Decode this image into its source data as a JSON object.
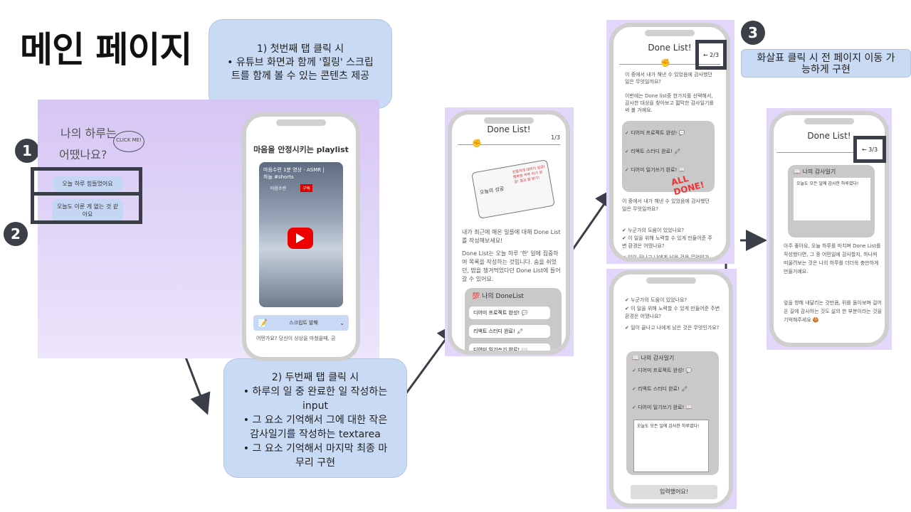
{
  "page_title": "메인 페이지",
  "callouts": {
    "first": [
      "1) 첫번째 탭 클릭 시",
      "• 유튜브 화면과 함께 '힐링' 스크립",
      "트를 함께 볼 수 있는 콘텐츠 제공"
    ],
    "second": [
      "2) 두번째 탭 클릭 시",
      "• 하루의 일 중 완료한 일 작성하는",
      "input",
      "• 그 요소 기억해서 그에 대한 작은",
      "감사일기를 작성하는 textarea",
      "• 그 요소 기억해서 마지막 최종 마",
      "무리 구현"
    ],
    "third": [
      "화살표 클릭 시 전 페이지 이동 가",
      "능하게 구현"
    ]
  },
  "badges": {
    "one": "1",
    "two": "2",
    "three": "3"
  },
  "main_panel": {
    "question_line1": "나의 하루는",
    "question_line2": "어땠나요?",
    "click_me": "CLICK ME!",
    "btn_hard": "오늘 하루 힘들었어요",
    "btn_nothing": "오늘도 이룬 게 없는 것 같아요"
  },
  "playlist_phone": {
    "title": "마음을 안정시키는 playlist",
    "video_title": "마음수련 1분 영상 - ASMR | 하늘 #shorts",
    "channel": "마음수련",
    "subscribe": "구독",
    "script_btn": "스크립트 발췌",
    "footer": "어떤가요? 당신이 상상을 마쳤을때, 긍"
  },
  "done_phone1": {
    "title": "Done List!",
    "step": "1/3",
    "book_left": "오늘의 성공",
    "book_right": "친절하게 대하기 성공! 행복한 하루 되기 성공! 결과 잘 받기!",
    "intro1": "내가 최근에 해온 일들에 대해 Done List를 작성해보세요!",
    "intro2": "Done List는 오늘 하루 '한' 일에 집중하여 목록을 작성하는 것입니다. 숨을 쉬었던, 밥을 챙겨먹었다던 Done List에 들어 갈 수 있어요.",
    "card_title": "나의 DoneList",
    "items": [
      "디어미 프로젝트 완성! 💬",
      "리액트 스터디 완료! 🖍",
      "디어미 일기쓰기 완료! 📖"
    ]
  },
  "done_phone2": {
    "title": "Done List!",
    "step": "← 2/3",
    "q1": "이 중에서 내가 해낸 수 있었음에 감사했던 일은 무엇일까요?",
    "q2": "이번에는 Done list중 한가지를 선택해서, 감사한 대상을 찾아보고 짧막한 감사일기를 써 볼 거예요.",
    "items": [
      "✓ 디어미 프로젝트 완성! 💬",
      "✓ 리액트 스터디 완료! 🖍",
      "✓ 디어미 일기쓰기 완료! 📖"
    ],
    "stamp": "ALL DONE!",
    "q3": "이 중에서 내가 해낸 수 있었음에 감사했던 일은 무엇일까요?",
    "checks": [
      "✔ 누군가의 도움이 있었나요?",
      "✔ 이 일을 위해 노력할 수 있게 만들어준 주변 환경은 어땠나요?",
      "✔ 일이 끝나고 나에게 남은 것은 무엇인가요?"
    ]
  },
  "done_phone3": {
    "checks": [
      "✔ 누군가의 도움이 있었나요?",
      "✔ 이 일을 위해 노력할 수 있게 만들어준 주변 환경은 어땠나요?",
      "✔ 일이 끝나고 나에게 남은 것은 무엇인가요?"
    ],
    "card_title": "📖 나의 감사일기",
    "items": [
      "✓ 디어미 프로젝트 완성! 💬",
      "✓ 리액트 스터디 완료! 🖍",
      "✓ 디어미 일기쓰기 완료! 📖"
    ],
    "textarea": "오늘도 모든 일에 감사한 하루였다!",
    "submit": "입력했어요!"
  },
  "done_phone4": {
    "title": "Done List!",
    "step": "← 3/3",
    "card_title": "📖 나의 감사일기",
    "diary": "오늘도 모든 일에 감사한 하루였다!",
    "para1": "아주 좋아요, 오늘 하루를 마치며 Done List를 작성했다면, 그 중 어떤일에 감사할지, 하나씩 떠올려보는 것은 나의 하루를 더더욱 충만하게 만들거예요.",
    "para2": "앞을 향해 내달리는 것만큼, 뒤를 돌아보며 걸어온 길에 감사하는 것도 삶의 한 부분이라는 것을 기억해주세요 🍪"
  }
}
